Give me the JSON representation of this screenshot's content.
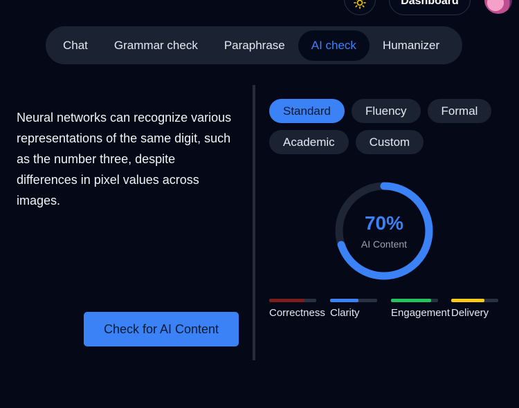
{
  "header": {
    "theme_icon": "sun-icon",
    "dashboard_label": "Dashboard",
    "avatar_icon": "user-avatar"
  },
  "tabs": [
    {
      "label": "Chat",
      "active": false
    },
    {
      "label": "Grammar check",
      "active": false
    },
    {
      "label": "Paraphrase",
      "active": false
    },
    {
      "label": "AI check",
      "active": true
    },
    {
      "label": "Humanizer",
      "active": false
    }
  ],
  "input": {
    "text": "Neural networks can recognize various representations of the same digit, such as the number three, despite differences in pixel values across images."
  },
  "check_button_label": "Check for AI Content",
  "modes": [
    {
      "label": "Standard",
      "active": true
    },
    {
      "label": "Fluency",
      "active": false
    },
    {
      "label": "Formal",
      "active": false
    },
    {
      "label": "Academic",
      "active": false
    },
    {
      "label": "Custom",
      "active": false
    }
  ],
  "result": {
    "percent": 70,
    "percent_text": "70%",
    "label": "AI Content"
  },
  "metrics": [
    {
      "label": "Correctness",
      "fill": 0.75,
      "color": "#7f1d1d"
    },
    {
      "label": "Clarity",
      "fill": 0.6,
      "color": "#3b82f6"
    },
    {
      "label": "Engagement",
      "fill": 0.85,
      "color": "#22c55e"
    },
    {
      "label": "Delivery",
      "fill": 0.7,
      "color": "#facc15"
    }
  ],
  "colors": {
    "accent": "#3b82f6",
    "background": "#040817",
    "panel": "#1b2333"
  }
}
